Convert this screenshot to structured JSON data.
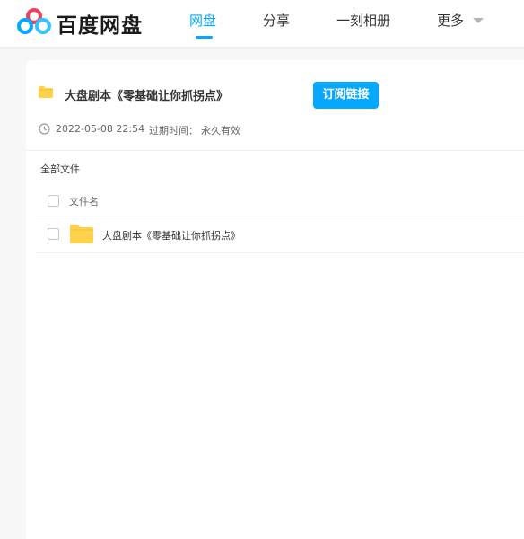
{
  "brand": {
    "name": "百度网盘"
  },
  "nav": {
    "items": [
      {
        "label": "网盘"
      },
      {
        "label": "分享"
      },
      {
        "label": "一刻相册"
      },
      {
        "label": "更多"
      }
    ]
  },
  "share": {
    "title": "大盘剧本《零基础让你抓拐点》",
    "subscribe_label": "订阅链接",
    "date": "2022-05-08 22:54",
    "expiry_label": "过期时间：",
    "expiry_value": "永久有效"
  },
  "file_list": {
    "breadcrumb": "全部文件",
    "column_name": "文件名",
    "rows": [
      {
        "name": "大盘剧本《零基础让你抓拐点》"
      }
    ]
  },
  "colors": {
    "accent": "#06a7ff",
    "folder": "#ffd24d"
  },
  "icons": [
    "baidu-netdisk-logo-icon",
    "folder-icon",
    "clock-icon",
    "chevron-down-icon"
  ]
}
